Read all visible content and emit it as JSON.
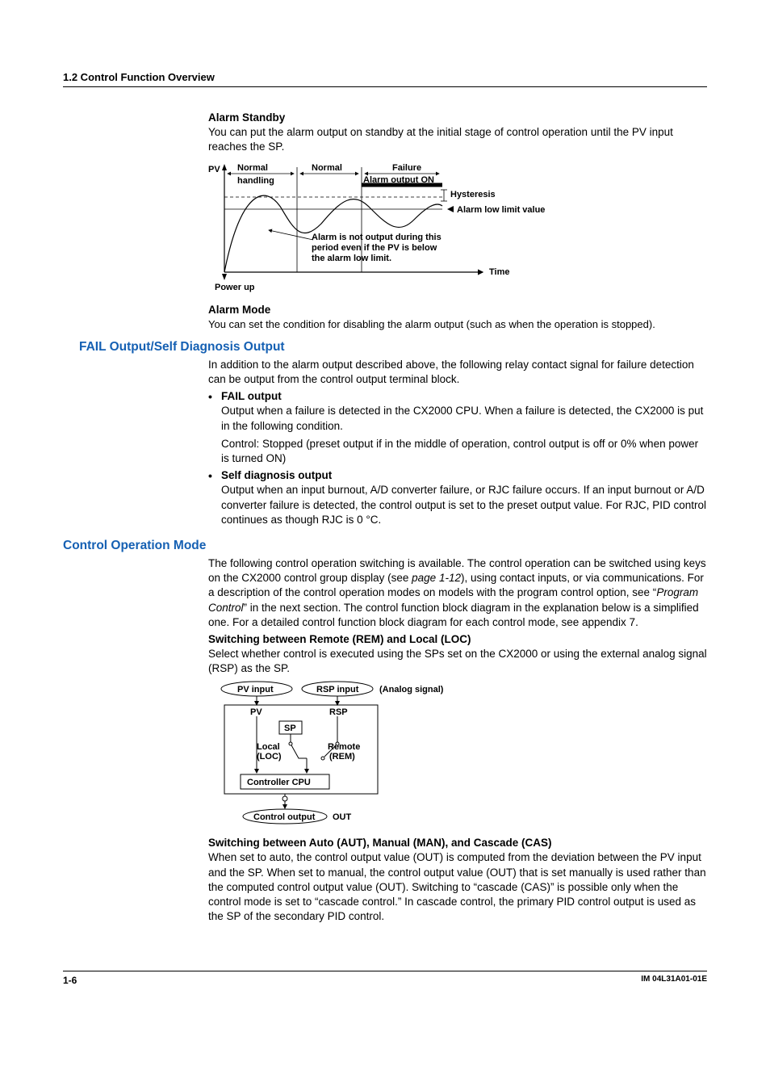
{
  "header": {
    "running": "1.2  Control Function Overview"
  },
  "alarmStandby": {
    "title": "Alarm Standby",
    "body": "You can put the alarm output on standby at the initial stage of control operation until the PV input reaches the SP."
  },
  "alarmDiag": {
    "pv": "PV",
    "normalHandling1": "Normal",
    "normalHandling2": "handling",
    "normal": "Normal",
    "failure": "Failure",
    "alarmOutputOn": "Alarm output ON",
    "hysteresis": "Hysteresis",
    "alarmLowLimit": "Alarm low limit value",
    "noteLine1": "Alarm is not output during this",
    "noteLine2": "period even if the PV is below",
    "noteLine3": "the alarm low limit.",
    "time": "Time",
    "powerUp": "Power up"
  },
  "alarmMode": {
    "title": "Alarm Mode",
    "body": "You can set the condition for disabling the alarm output (such as when the operation is stopped)."
  },
  "failOutput": {
    "title": "FAIL Output/Self Diagnosis Output",
    "intro": "In addition to the alarm output described above, the following relay contact signal for failure detection can be output from the control output terminal block.",
    "fail": {
      "title": "FAIL output",
      "p1": "Output when a failure is detected in the CX2000 CPU.  When a failure is detected, the CX2000 is put in the following condition.",
      "p2": "Control: Stopped (preset output if in the middle of operation, control output is off or 0% when power is turned ON)"
    },
    "self": {
      "title": "Self diagnosis output",
      "p1": "Output when an input burnout, A/D converter failure, or RJC failure occurs.  If an input burnout or A/D converter failure is detected, the control output is set to the preset output value.  For RJC, PID control continues as though RJC is 0 °C."
    }
  },
  "controlMode": {
    "title": "Control Operation Mode",
    "introPre": "The following control operation switching is available.  The control operation can be switched using keys on the CX2000 control group display (see ",
    "pageRef": "page 1-12",
    "introMid": "), using contact inputs, or via communications.  For a description of the control operation modes on models with the program control option, see “",
    "programControl": "Program Control",
    "introPost": "” in the next section.  The control function block diagram in the explanation below is a simplified one.  For a detailed control function block diagram for each control mode, see appendix 7.",
    "switchRemLoc": {
      "title": "Switching between Remote (REM) and Local (LOC)",
      "body": "Select whether control is executed using the SPs set on the CX2000 or using the external analog signal (RSP) as the SP."
    },
    "switchAuto": {
      "title": "Switching between Auto (AUT), Manual (MAN), and Cascade (CAS)",
      "body": "When set to auto, the control output value (OUT) is computed from the deviation between the PV input and the SP.  When set to manual, the control output value (OUT) that is set manually is used rather than the computed control output value (OUT).  Switching to “cascade (CAS)” is possible only when the control mode is set to “cascade control.”  In cascade control, the primary PID control output is used as the SP of the secondary PID control."
    }
  },
  "blockDiag": {
    "pvInput": "PV input",
    "rspInput": "RSP input",
    "analog": "(Analog signal)",
    "pv": "PV",
    "rsp": "RSP",
    "sp": "SP",
    "local1": "Local",
    "local2": "(LOC)",
    "remote1": "Remote",
    "remote2": "(REM)",
    "cpu": "Controller CPU",
    "controlOutput": "Control output",
    "out": "OUT"
  },
  "footer": {
    "page": "1-6",
    "doc": "IM 04L31A01-01E"
  }
}
